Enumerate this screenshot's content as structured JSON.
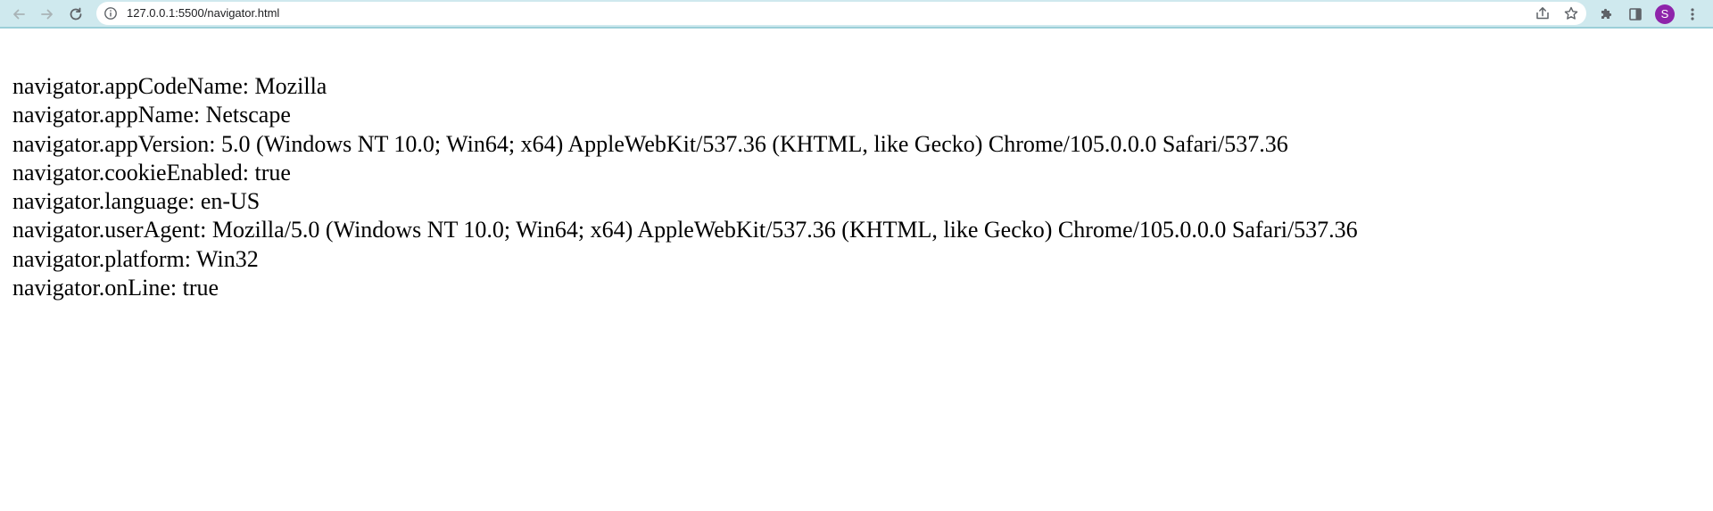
{
  "browser": {
    "url": "127.0.0.1:5500/navigator.html",
    "profile_initial": "S",
    "profile_color": "#8e24aa",
    "toolbar_color": "#cfe9ee"
  },
  "page": {
    "lines": [
      "navigator.appCodeName: Mozilla",
      "navigator.appName: Netscape",
      "navigator.appVersion: 5.0 (Windows NT 10.0; Win64; x64) AppleWebKit/537.36 (KHTML, like Gecko) Chrome/105.0.0.0 Safari/537.36",
      "navigator.cookieEnabled: true",
      "navigator.language: en-US",
      "navigator.userAgent: Mozilla/5.0 (Windows NT 10.0; Win64; x64) AppleWebKit/537.36 (KHTML, like Gecko) Chrome/105.0.0.0 Safari/537.36",
      "navigator.platform: Win32",
      "navigator.onLine: true"
    ]
  }
}
